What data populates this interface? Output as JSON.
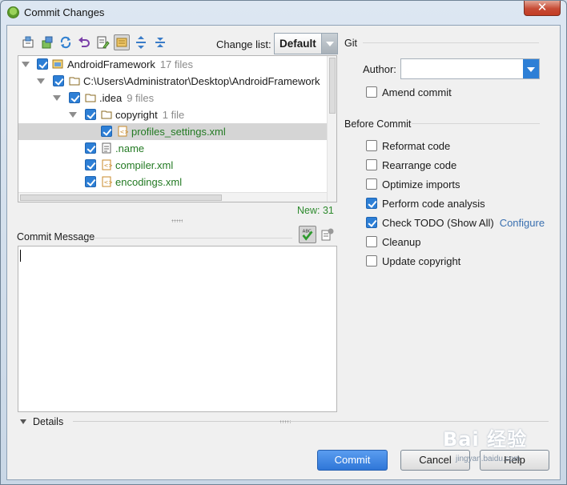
{
  "window": {
    "title": "Commit Changes",
    "close_glyph": "✕"
  },
  "toolbar": {
    "icons": [
      "show-diff-icon",
      "move-to-changelist-icon",
      "refresh-icon",
      "rollback-icon",
      "edit-source-icon",
      "group-by-directory-icon",
      "expand-all-icon",
      "collapse-all-icon"
    ],
    "changelist_label": "Change list:",
    "changelist_value": "Default"
  },
  "tree": {
    "rows": [
      {
        "label": "AndroidFramework",
        "count": "17 files",
        "icon": "project-icon",
        "green": false
      },
      {
        "label": "C:\\Users\\Administrator\\Desktop\\AndroidFramework",
        "count": "",
        "icon": "folder-icon",
        "green": false
      },
      {
        "label": ".idea",
        "count": "9 files",
        "icon": "folder-icon",
        "green": false
      },
      {
        "label": "copyright",
        "count": "1 file",
        "icon": "folder-icon",
        "green": false
      },
      {
        "label": "profiles_settings.xml",
        "count": "",
        "icon": "xml-file-icon",
        "green": true,
        "selected": true
      },
      {
        "label": ".name",
        "count": "",
        "icon": "text-file-icon",
        "green": true
      },
      {
        "label": "compiler.xml",
        "count": "",
        "icon": "xml-file-icon",
        "green": true
      },
      {
        "label": "encodings.xml",
        "count": "",
        "icon": "xml-file-icon",
        "green": true
      }
    ],
    "new_count": "New: 31"
  },
  "commit_message": {
    "label": "Commit Message",
    "value": ""
  },
  "details": {
    "label": "Details"
  },
  "git": {
    "section_label": "Git",
    "author_label": "Author:",
    "author_value": "",
    "amend_label": "Amend commit",
    "amend_checked": false
  },
  "before_commit": {
    "section_label": "Before Commit",
    "options": [
      {
        "label": "Reformat code",
        "checked": false
      },
      {
        "label": "Rearrange code",
        "checked": false
      },
      {
        "label": "Optimize imports",
        "checked": false
      },
      {
        "label": "Perform code analysis",
        "checked": true
      },
      {
        "label": "Check TODO (Show All)",
        "checked": true,
        "link": "Configure"
      },
      {
        "label": "Cleanup",
        "checked": false
      },
      {
        "label": "Update copyright",
        "checked": false
      }
    ]
  },
  "buttons": {
    "commit": "Commit",
    "cancel": "Cancel",
    "help": "Help"
  },
  "watermark": {
    "brand": "Bai 经验",
    "url": "jingyan.baidu.com"
  },
  "colors": {
    "accent": "#2d7fd6",
    "new_file_green": "#237a23",
    "link": "#3a70b0"
  }
}
